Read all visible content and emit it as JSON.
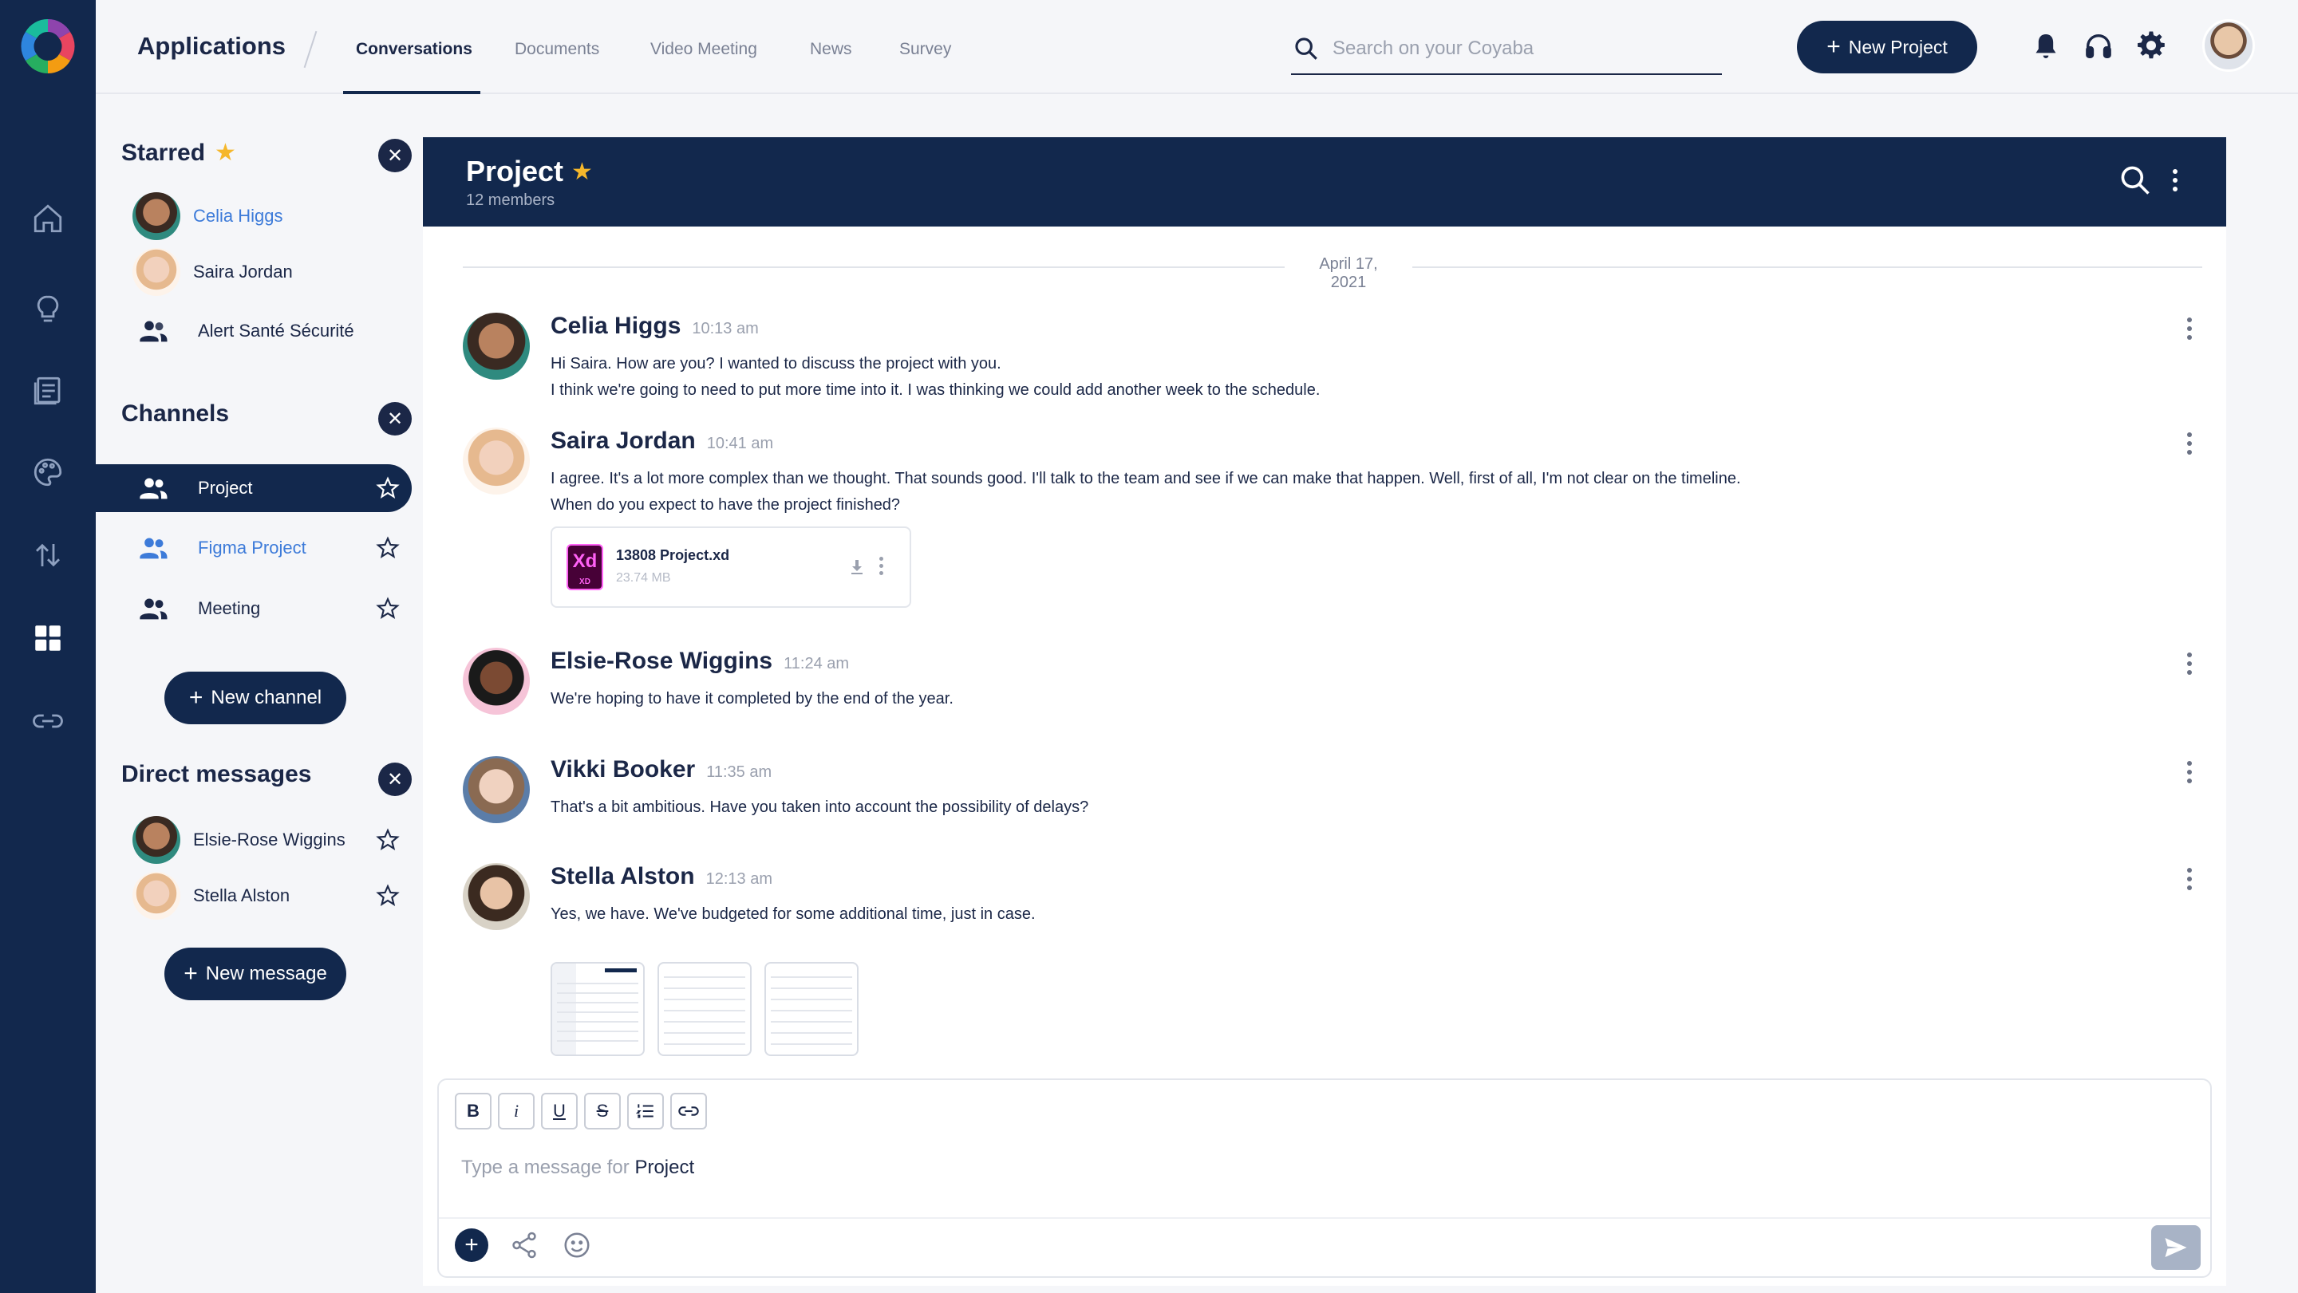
{
  "topbar": {
    "title": "Applications",
    "tabs": [
      {
        "label": "Conversations",
        "active": true
      },
      {
        "label": "Documents"
      },
      {
        "label": "Video Meeting"
      },
      {
        "label": "News"
      },
      {
        "label": "Survey"
      }
    ],
    "search_placeholder": "Search on your Coyaba",
    "new_project_label": "New Project",
    "icons": [
      "bell-icon",
      "headset-icon",
      "gear-icon",
      "user-avatar"
    ]
  },
  "rail": {
    "icons": [
      "home-icon",
      "lightbulb-icon",
      "news-icon",
      "palette-icon",
      "sort-arrows-icon",
      "dashboard-icon",
      "link-icon"
    ]
  },
  "starred": {
    "title": "Starred",
    "items": [
      {
        "label": "Celia Higgs",
        "highlight": true
      },
      {
        "label": "Saira Jordan"
      },
      {
        "label": "Alert Santé Sécurité"
      }
    ]
  },
  "channels": {
    "title": "Channels",
    "items": [
      {
        "label": "Project",
        "active": true
      },
      {
        "label": "Figma Project",
        "highlight": true
      },
      {
        "label": "Meeting"
      }
    ],
    "new_label": "New channel"
  },
  "direct": {
    "title": "Direct messages",
    "items": [
      {
        "label": "Elsie-Rose Wiggins"
      },
      {
        "label": "Stella Alston"
      }
    ],
    "new_label": "New message"
  },
  "chat": {
    "title": "Project",
    "members": "12 members",
    "date": "April 17, 2021",
    "messages": [
      {
        "author": "Celia Higgs",
        "time": "10:13 am",
        "lines": [
          "Hi Saira. How are you?  I wanted to discuss the project with you.",
          "I think we're going to need to put more time into it. I was thinking we could add another week to the schedule."
        ]
      },
      {
        "author": "Saira Jordan",
        "time": "10:41 am",
        "lines": [
          "I agree. It's a lot more complex than we thought. That sounds good. I'll talk to the team and see if we can make that happen. Well, first of all, I'm not clear on the timeline.",
          "When do you expect to have the project finished?"
        ],
        "file": {
          "name": "13808 Project.xd",
          "size": "23.74 MB",
          "type": "Xd"
        }
      },
      {
        "author": "Elsie-Rose Wiggins",
        "time": "11:24 am",
        "lines": [
          "We're hoping to have it completed by the end of the year."
        ]
      },
      {
        "author": "Vikki Booker",
        "time": "11:35 am",
        "lines": [
          "That's a bit ambitious. Have you taken into account the possibility of delays?"
        ]
      },
      {
        "author": "Stella Alston",
        "time": "12:13 am",
        "lines": [
          "Yes, we have. We've budgeted for some additional time, just in case."
        ]
      }
    ]
  },
  "composer": {
    "format_buttons": [
      "B",
      "i",
      "U",
      "S",
      "list",
      "link"
    ],
    "placeholder_prefix": "Type a message for",
    "placeholder_target": "Project"
  },
  "colors": {
    "navy": "#12284d",
    "accent_blue": "#3d7bd9",
    "star_gold": "#f5b72b"
  }
}
